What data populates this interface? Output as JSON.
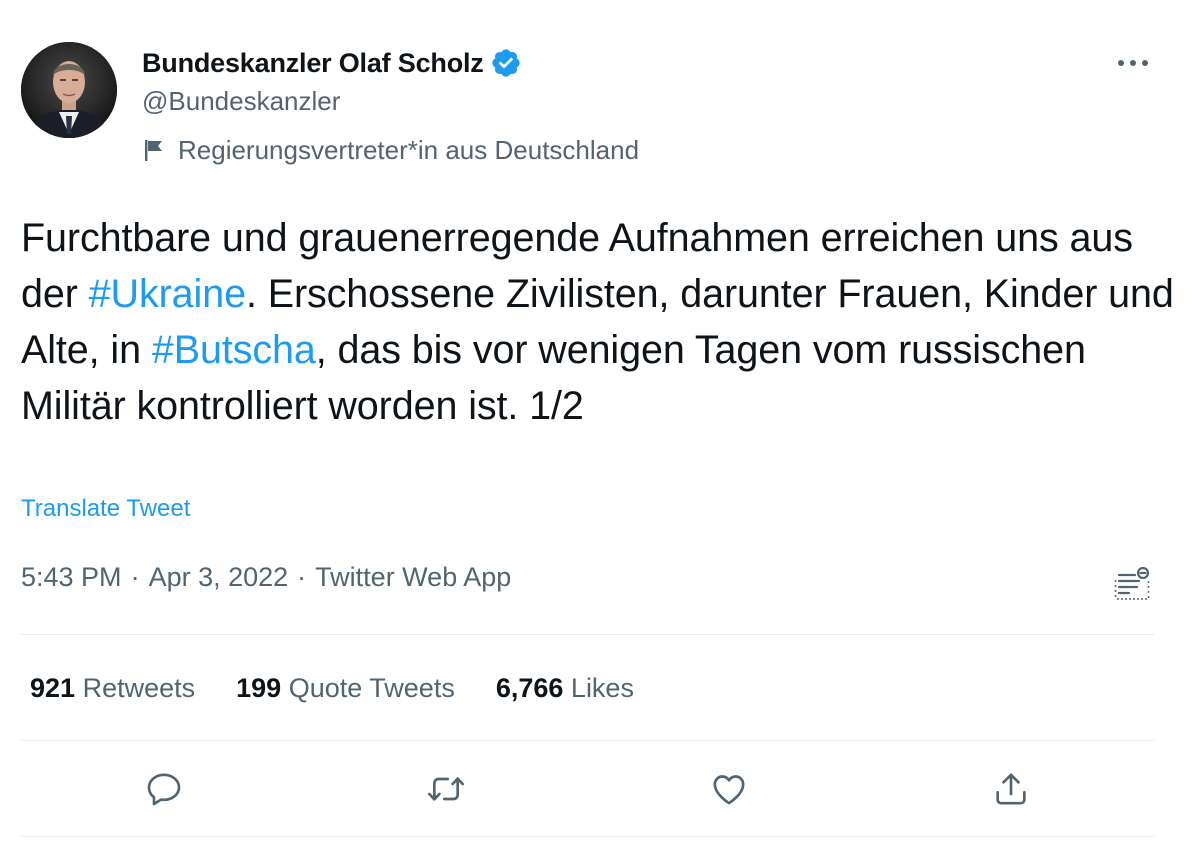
{
  "author": {
    "display_name": "Bundeskanzler Olaf Scholz",
    "handle": "@Bundeskanzler",
    "verified_icon": "verified-badge-icon",
    "label": "Regierungsvertreter*in aus Deutschland",
    "label_icon": "flag-icon"
  },
  "tweet": {
    "text_parts": [
      "Furchtbare und grauenerregende Aufnahmen erreichen uns aus der ",
      "#Ukraine",
      ". Erschossene Zivilisten, darunter Frauen, Kinder und Alte, in ",
      "#Butscha",
      ", das bis vor wenigen Tagen vom russischen Militär kontrolliert worden ist. 1/2"
    ],
    "translate_label": "Translate Tweet",
    "time": "5:43 PM",
    "date": "Apr 3, 2022",
    "source": "Twitter Web App",
    "separator": "·"
  },
  "stats": {
    "retweets_count": "921",
    "retweets_label": "Retweets",
    "quotes_count": "199",
    "quotes_label": "Quote Tweets",
    "likes_count": "6,766",
    "likes_label": "Likes"
  },
  "actions": [
    "reply-icon",
    "retweet-icon",
    "like-icon",
    "share-icon"
  ],
  "colors": {
    "accent": "#1d9bf0",
    "text_primary": "#0f1419",
    "text_secondary": "#536471",
    "divider": "#e6ecf0"
  }
}
